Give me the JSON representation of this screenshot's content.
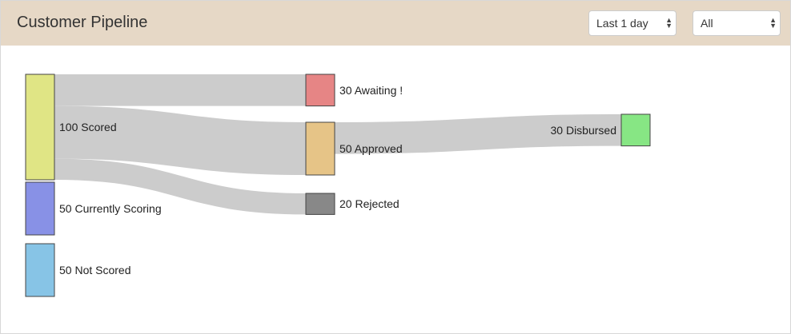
{
  "header": {
    "title": "Customer Pipeline",
    "range_select": {
      "value": "Last 1 day",
      "arrows": "▲▼"
    },
    "filter_select": {
      "value": "All",
      "arrows": "▲▼"
    }
  },
  "colors": {
    "header_bg": "#e6d8c6",
    "link": "#cccccc",
    "scored": "#e0e585",
    "currently_scoring": "#8891e6",
    "not_scored": "#87c4e6",
    "awaiting": "#e68585",
    "approved": "#e6c487",
    "rejected": "#888888",
    "disbursed": "#87e684",
    "alert_text": "#ff0000"
  },
  "chart_data": {
    "type": "sankey",
    "title": "",
    "nodes": [
      {
        "id": "scored",
        "label": "100 Scored",
        "value": 100,
        "column": 0,
        "color": "#e0e585"
      },
      {
        "id": "currently_scoring",
        "label": "50 Currently Scoring",
        "value": 50,
        "column": 0,
        "color": "#8891e6"
      },
      {
        "id": "not_scored",
        "label": "50 Not Scored",
        "value": 50,
        "column": 0,
        "color": "#87c4e6"
      },
      {
        "id": "awaiting",
        "label": "30 Awaiting !",
        "value": 30,
        "column": 1,
        "color": "#e68585",
        "alert": true
      },
      {
        "id": "approved",
        "label": "50 Approved",
        "value": 50,
        "column": 1,
        "color": "#e6c487"
      },
      {
        "id": "rejected",
        "label": "20 Rejected",
        "value": 20,
        "column": 1,
        "color": "#888888"
      },
      {
        "id": "disbursed",
        "label": "30 Disbursed",
        "value": 30,
        "column": 2,
        "color": "#87e684"
      }
    ],
    "links": [
      {
        "source": "scored",
        "target": "awaiting",
        "value": 30
      },
      {
        "source": "scored",
        "target": "approved",
        "value": 50
      },
      {
        "source": "scored",
        "target": "rejected",
        "value": 20
      },
      {
        "source": "approved",
        "target": "disbursed",
        "value": 30
      }
    ]
  }
}
